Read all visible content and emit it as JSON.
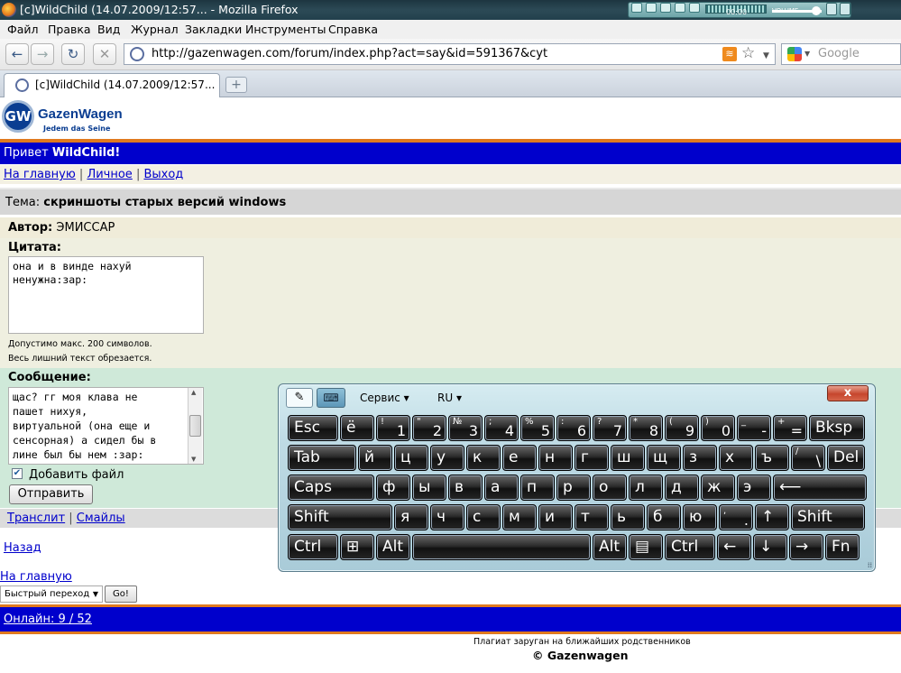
{
  "window": {
    "title": "[c]WildChild (14.07.2009/12:57... - Mozilla Firefox",
    "media_volume_label": "VOLUME",
    "media_display": "00:00"
  },
  "menu": [
    "Файл",
    "Правка",
    "Вид",
    "Журнал",
    "Закладки",
    "Инструменты",
    "Справка"
  ],
  "toolbar": {
    "url": "http://gazenwagen.com/forum/index.php?act=say&id=591367&cyt",
    "search_placeholder": "Google"
  },
  "tabs": [
    {
      "label": "[c]WildChild (14.07.2009/12:57..."
    }
  ],
  "site": {
    "logo_title": "GazenWagen",
    "logo_slogan": "Jedem das Seine",
    "logo_mark": "GW"
  },
  "greeting": {
    "prefix": "Привет",
    "user": "WildChild!"
  },
  "nav_links": [
    "На главную",
    "Личное",
    "Выход"
  ],
  "topic": {
    "label": "Тема:",
    "title": "скриншоты старых версий windows"
  },
  "author": {
    "label": "Автор:",
    "name": "ЭМИССАР"
  },
  "quote": {
    "label": "Цитата:",
    "text": "она и в винде нахуй\nненужна:зар:",
    "note1": "Допустимо макс. 200 символов.",
    "note2": "Весь лишний текст обрезается."
  },
  "message": {
    "label": "Сообщение:",
    "text": "щас? гг моя клава не\nпашет нихуя,\nвиртуальной (она еще и\nсенсорная) а сидел бы в\nлине был бы нем :зар:",
    "attach_label": "Добавить файл",
    "attach_checked": true,
    "send_label": "Отправить"
  },
  "tools": {
    "translit": "Транслит",
    "smileys": "Смайлы"
  },
  "back_link": "Назад",
  "home_link": "На главную",
  "quick_jump": {
    "selected": "Быстрый переход",
    "go": "Go!"
  },
  "online": "Онлайн: 9 / 52",
  "footer": {
    "line1": "Плагиат заруган на ближайших родственников",
    "line2": "© Gazenwagen"
  },
  "osk": {
    "service": "Сервис",
    "lang": "RU",
    "close": "x",
    "row1": [
      {
        "m": "Esc"
      },
      {
        "m": "ё"
      },
      {
        "s": "!",
        "n": "1"
      },
      {
        "s": "\"",
        "n": "2"
      },
      {
        "s": "№",
        "n": "3"
      },
      {
        "s": ";",
        "n": "4"
      },
      {
        "s": "%",
        "n": "5"
      },
      {
        "s": ":",
        "n": "6"
      },
      {
        "s": "?",
        "n": "7"
      },
      {
        "s": "*",
        "n": "8"
      },
      {
        "s": "(",
        "n": "9"
      },
      {
        "s": ")",
        "n": "0"
      },
      {
        "s": "_",
        "n": "-"
      },
      {
        "s": "+",
        "n": "="
      },
      {
        "m": "Bksp"
      }
    ],
    "row2": [
      {
        "m": "Tab"
      },
      {
        "m": "й"
      },
      {
        "m": "ц"
      },
      {
        "m": "у"
      },
      {
        "m": "к"
      },
      {
        "m": "е"
      },
      {
        "m": "н"
      },
      {
        "m": "г"
      },
      {
        "m": "ш"
      },
      {
        "m": "щ"
      },
      {
        "m": "з"
      },
      {
        "m": "х"
      },
      {
        "m": "ъ"
      },
      {
        "s": "/",
        "n": "\\"
      },
      {
        "m": "Del"
      }
    ],
    "row3": [
      {
        "m": "Caps"
      },
      {
        "m": "ф"
      },
      {
        "m": "ы"
      },
      {
        "m": "в"
      },
      {
        "m": "а"
      },
      {
        "m": "п"
      },
      {
        "m": "р"
      },
      {
        "m": "о"
      },
      {
        "m": "л"
      },
      {
        "m": "д"
      },
      {
        "m": "ж"
      },
      {
        "m": "э"
      },
      {
        "m": "⟵"
      }
    ],
    "row4": [
      {
        "m": "Shift"
      },
      {
        "m": "я"
      },
      {
        "m": "ч"
      },
      {
        "m": "с"
      },
      {
        "m": "м"
      },
      {
        "m": "и"
      },
      {
        "m": "т"
      },
      {
        "m": "ь"
      },
      {
        "m": "б"
      },
      {
        "m": "ю"
      },
      {
        "s": ",",
        "n": "."
      },
      {
        "m": "↑"
      },
      {
        "m": "Shift"
      }
    ],
    "row5": [
      {
        "m": "Ctrl"
      },
      {
        "m": "⊞"
      },
      {
        "m": "Alt"
      },
      {
        "m": ""
      },
      {
        "m": "Alt"
      },
      {
        "m": "▤"
      },
      {
        "m": "Ctrl"
      },
      {
        "m": "←"
      },
      {
        "m": "↓"
      },
      {
        "m": "→"
      },
      {
        "m": "Fn"
      }
    ]
  },
  "colors": {
    "blue_bar": "#0000cc",
    "orange_rule": "#e07a1f",
    "link": "#0000cc"
  }
}
